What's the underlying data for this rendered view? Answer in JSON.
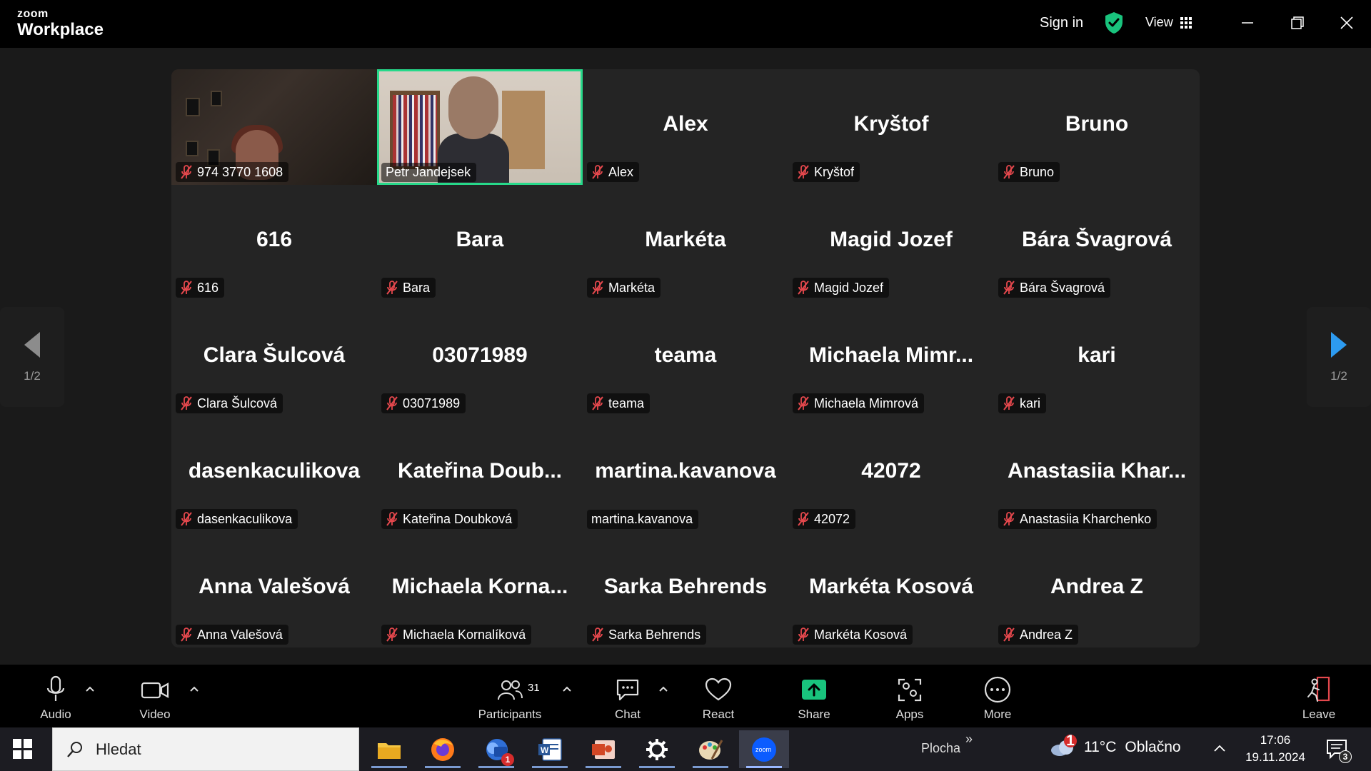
{
  "titlebar": {
    "brand_small": "zoom",
    "brand_large": "Workplace",
    "sign_in": "Sign in",
    "view": "View"
  },
  "gallery": {
    "tiles": [
      {
        "big": "",
        "label": "974 3770 1608",
        "muted": true,
        "video": "woman"
      },
      {
        "big": "",
        "label": "Petr Jandejsek",
        "muted": false,
        "video": "man",
        "active_speaker": true
      },
      {
        "big": "Alex",
        "label": "Alex",
        "muted": true
      },
      {
        "big": "Kryštof",
        "label": "Kryštof",
        "muted": true
      },
      {
        "big": "Bruno",
        "label": "Bruno",
        "muted": true
      },
      {
        "big": "616",
        "label": "616",
        "muted": true
      },
      {
        "big": "Bara",
        "label": "Bara",
        "muted": true
      },
      {
        "big": "Markéta",
        "label": "Markéta",
        "muted": true
      },
      {
        "big": "Magid Jozef",
        "label": "Magid Jozef",
        "muted": true
      },
      {
        "big": "Bára Švagrová",
        "label": "Bára Švagrová",
        "muted": true
      },
      {
        "big": "Clara Šulcová",
        "label": "Clara Šulcová",
        "muted": true
      },
      {
        "big": "03071989",
        "label": "03071989",
        "muted": true
      },
      {
        "big": "teama",
        "label": "teama",
        "muted": true
      },
      {
        "big": "Michaela  Mimr...",
        "label": "Michaela Mimrová",
        "muted": true
      },
      {
        "big": "kari",
        "label": "kari",
        "muted": true
      },
      {
        "big": "dasenkaculikova",
        "label": "dasenkaculikova",
        "muted": true
      },
      {
        "big": "Kateřina   Doub...",
        "label": "Kateřina  Doubková",
        "muted": true
      },
      {
        "big": "martina.kavanova",
        "label": "martina.kavanova",
        "muted": false
      },
      {
        "big": "42072",
        "label": "42072",
        "muted": true
      },
      {
        "big": "Anastasiia  Khar...",
        "label": "Anastasiia Kharchenko",
        "muted": true
      },
      {
        "big": "Anna Valešová",
        "label": "Anna Valešová",
        "muted": true
      },
      {
        "big": "Michaela  Korna...",
        "label": "Michaela Kornalíková",
        "muted": true
      },
      {
        "big": "Sarka Behrends",
        "label": "Sarka Behrends",
        "muted": true
      },
      {
        "big": "Markéta Kosová",
        "label": "Markéta Kosová",
        "muted": true
      },
      {
        "big": "Andrea Z",
        "label": "Andrea Z",
        "muted": true
      }
    ]
  },
  "pager": {
    "left_page": "1/2",
    "right_page": "1/2"
  },
  "toolbar": {
    "audio": "Audio",
    "video": "Video",
    "participants": "Participants",
    "participants_count": "31",
    "chat": "Chat",
    "react": "React",
    "share": "Share",
    "apps": "Apps",
    "more": "More",
    "leave": "Leave"
  },
  "taskbar": {
    "search_placeholder": "Hledat",
    "desktop_label": "Plocha",
    "weather_temp": "11°C",
    "weather_desc": "Oblačno",
    "weather_badge": "1",
    "outlook_badge": "1",
    "time": "17:06",
    "date": "19.11.2024",
    "notif_count": "3"
  },
  "colors": {
    "active_speaker": "#27d98a",
    "muted_red": "#e5484d",
    "share_green": "#19c37d",
    "nav_arrow_blue": "#2d9bf0"
  }
}
